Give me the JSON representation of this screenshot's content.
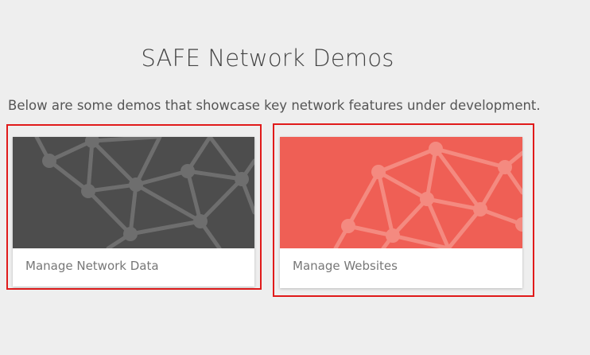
{
  "header": {
    "title": "SAFE Network Demos"
  },
  "intro": {
    "text": "Below are some demos that showcase key network features under development."
  },
  "cards": [
    {
      "label": "Manage Network Data",
      "image_color": "#4d4d4d",
      "pattern_color": "#6e6e6e"
    },
    {
      "label": "Manage Websites",
      "image_color": "#ef5f55",
      "pattern_color": "#f48a80"
    }
  ],
  "highlight_color": "#e01a1a"
}
